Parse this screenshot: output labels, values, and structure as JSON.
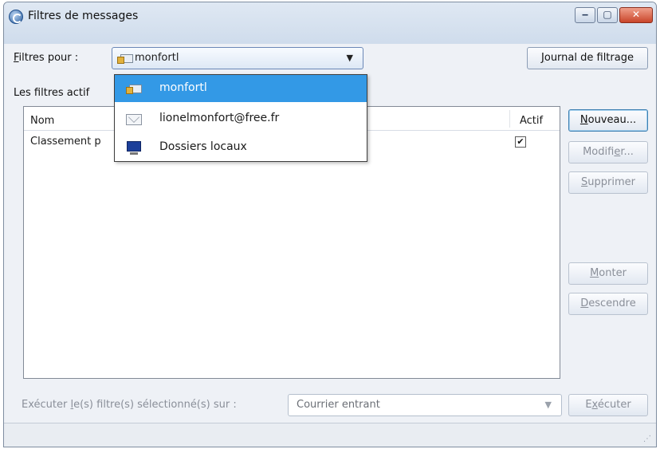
{
  "window": {
    "title": "Filtres de messages"
  },
  "caption_buttons": {
    "minimize": "‒",
    "maximize": "▢",
    "close": "✕"
  },
  "filters_for": {
    "label_mnemonic": "F",
    "label_rest": "iltres pour :",
    "selected_value": "monfortl"
  },
  "log_button": {
    "mnemonic": "J",
    "rest": "ournal de filtrage"
  },
  "active_filters_label": "Les filtres actif",
  "list": {
    "columns": {
      "name": "Nom",
      "active": "Actif"
    },
    "rows": [
      {
        "name": "Classement p",
        "active_mark": "✔"
      }
    ]
  },
  "side_buttons": {
    "new": {
      "mnemonic": "N",
      "rest": "ouveau..."
    },
    "edit": {
      "before": "Modifi",
      "mnemonic": "e",
      "after": "r..."
    },
    "delete": {
      "mnemonic": "S",
      "rest": "upprimer"
    },
    "up": {
      "mnemonic": "M",
      "rest": "onter"
    },
    "down": {
      "mnemonic": "D",
      "rest": "escendre"
    }
  },
  "run": {
    "label_before": "Exécuter ",
    "label_mnemonic": "l",
    "label_after": "e(s) filtre(s) sélectionné(s) sur :",
    "select_value": "Courrier entrant",
    "button": {
      "before": "E",
      "mnemonic": "x",
      "after": "écuter"
    }
  },
  "dropdown": {
    "items": [
      {
        "label": "monfortl",
        "icon": "account-lock-icon",
        "selected": true
      },
      {
        "label": "lionelmonfort@free.fr",
        "icon": "mail-envelope-icon",
        "selected": false
      },
      {
        "label": "Dossiers locaux",
        "icon": "local-folders-icon",
        "selected": false
      }
    ]
  },
  "colors": {
    "selection": "#3399e6",
    "window_bg": "#eef1f6"
  }
}
